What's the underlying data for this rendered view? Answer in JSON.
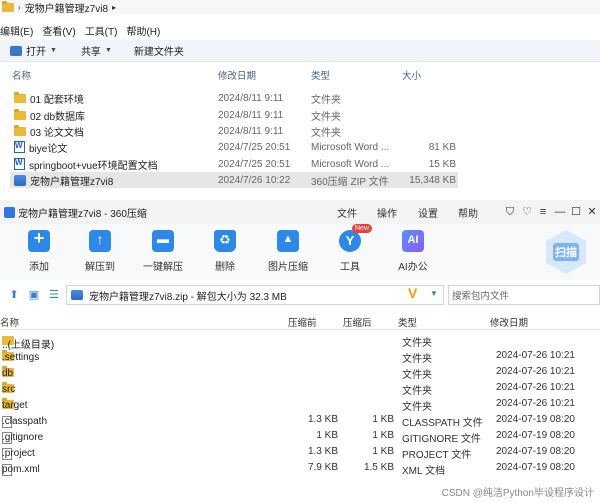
{
  "explorer": {
    "title": "宠物户籍管理z7vi8",
    "menu": [
      "编辑(E)",
      "查看(V)",
      "工具(T)",
      "帮助(H)"
    ],
    "toolbar": {
      "open": "打开",
      "share": "共享",
      "new_folder": "新建文件夹"
    },
    "columns": {
      "name": "名称",
      "date": "修改日期",
      "type": "类型",
      "size": "大小"
    },
    "rows": [
      {
        "name": "01 配套环境",
        "date": "2024/8/11 9:11",
        "type": "文件夹",
        "size": "",
        "icon": "folder-icon"
      },
      {
        "name": "02 db数据库",
        "date": "2024/8/11 9:11",
        "type": "文件夹",
        "size": "",
        "icon": "folder-icon"
      },
      {
        "name": "03 论文文档",
        "date": "2024/8/11 9:11",
        "type": "文件夹",
        "size": "",
        "icon": "folder-icon"
      },
      {
        "name": "biye论文",
        "date": "2024/7/25 20:51",
        "type": "Microsoft Word ...",
        "size": "81 KB",
        "icon": "word-icon"
      },
      {
        "name": "springboot+vue环境配置文档",
        "date": "2024/7/25 20:51",
        "type": "Microsoft Word ...",
        "size": "15 KB",
        "icon": "word-icon"
      },
      {
        "name": "宠物户籍管理z7vi8",
        "date": "2024/7/26 10:22",
        "type": "360压缩 ZIP 文件",
        "size": "15,348 KB",
        "icon": "zip-icon"
      }
    ]
  },
  "zip": {
    "title": "宠物户籍管理z7vi8 - 360压缩",
    "menu": {
      "file": "文件",
      "op": "操作",
      "settings": "设置",
      "help": "帮助"
    },
    "tools": {
      "add": "添加",
      "extract": "解压到",
      "oneclick": "一键解压",
      "delete": "删除",
      "img": "图片压缩",
      "tools": "工具",
      "ai": "AI办公"
    },
    "new_badge": "New",
    "scan": "扫描",
    "address": "宠物户籍管理z7vi8.zip - 解包大小为 32.3 MB",
    "search_placeholder": "搜索包内文件",
    "columns": {
      "name": "名称",
      "csize": "压缩前",
      "psize": "压缩后",
      "type": "类型",
      "date": "修改日期"
    },
    "rows": [
      {
        "name": "..(上级目录)",
        "csize": "",
        "psize": "",
        "type": "文件夹",
        "date": "",
        "icon": "folder-icon"
      },
      {
        "name": ".settings",
        "csize": "",
        "psize": "",
        "type": "文件夹",
        "date": "2024-07-26 10:21",
        "icon": "folder-icon"
      },
      {
        "name": "db",
        "csize": "",
        "psize": "",
        "type": "文件夹",
        "date": "2024-07-26 10:21",
        "icon": "folder-icon"
      },
      {
        "name": "src",
        "csize": "",
        "psize": "",
        "type": "文件夹",
        "date": "2024-07-26 10:21",
        "icon": "folder-icon"
      },
      {
        "name": "target",
        "csize": "",
        "psize": "",
        "type": "文件夹",
        "date": "2024-07-26 10:21",
        "icon": "folder-icon"
      },
      {
        "name": ".classpath",
        "csize": "1.3 KB",
        "psize": "1 KB",
        "type": "CLASSPATH 文件",
        "date": "2024-07-19 08:20",
        "icon": "file-icon"
      },
      {
        "name": ".gitignore",
        "csize": "1 KB",
        "psize": "1 KB",
        "type": "GITIGNORE 文件",
        "date": "2024-07-19 08:20",
        "icon": "file-icon"
      },
      {
        "name": ".project",
        "csize": "1.3 KB",
        "psize": "1 KB",
        "type": "PROJECT 文件",
        "date": "2024-07-19 08:20",
        "icon": "file-icon"
      },
      {
        "name": "pom.xml",
        "csize": "7.9 KB",
        "psize": "1.5 KB",
        "type": "XML 文档",
        "date": "2024-07-19 08:20",
        "icon": "file-icon"
      }
    ]
  },
  "watermark": "CSDN @纯洁Python毕设程序设计"
}
